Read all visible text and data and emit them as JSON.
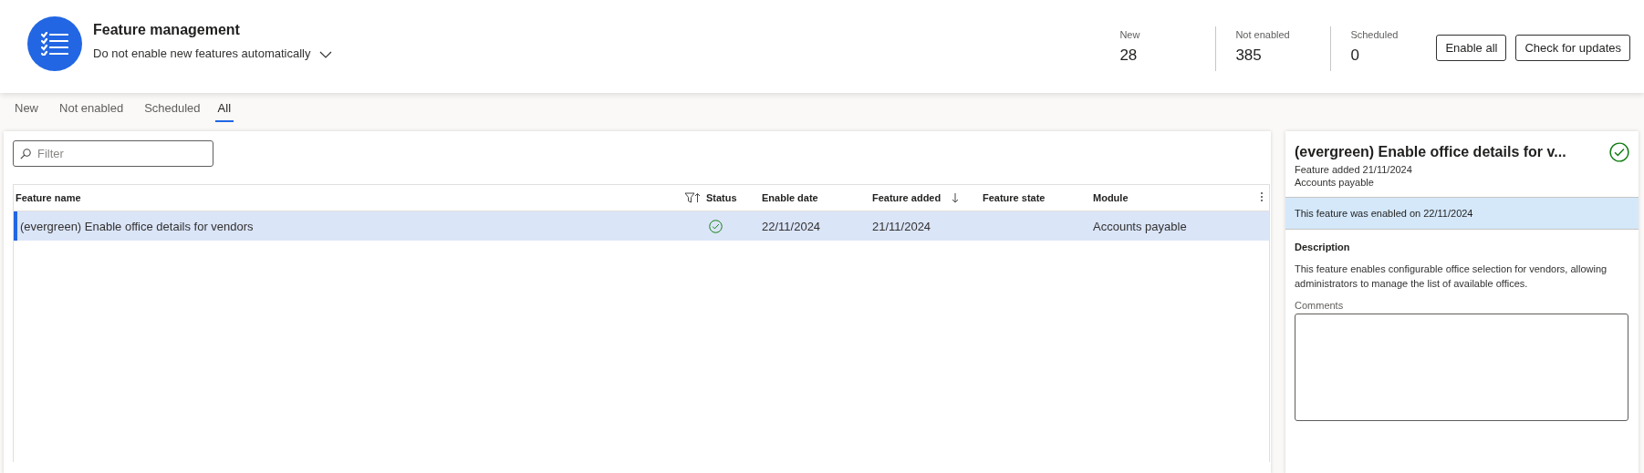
{
  "header": {
    "title": "Feature management",
    "automation_setting": "Do not enable new features automatically"
  },
  "stats": [
    {
      "label": "New",
      "value": "28"
    },
    {
      "label": "Not enabled",
      "value": "385"
    },
    {
      "label": "Scheduled",
      "value": "0"
    }
  ],
  "buttons": [
    "Enable all",
    "Check for updates"
  ],
  "tabs": [
    {
      "label": "New",
      "selected": false
    },
    {
      "label": "Not enabled",
      "selected": false
    },
    {
      "label": "Scheduled",
      "selected": false
    },
    {
      "label": "All",
      "selected": true
    }
  ],
  "filter": {
    "placeholder": "Filter"
  },
  "table": {
    "columns": [
      {
        "label": "Feature name",
        "filtered": true
      },
      {
        "label": "Status",
        "filtered": false
      },
      {
        "label": "Enable date",
        "filtered": false
      },
      {
        "label": "Feature added",
        "filtered": false,
        "sorted_descending": true
      },
      {
        "label": "Feature state",
        "filtered": false
      },
      {
        "label": "Module",
        "filtered": false
      }
    ],
    "rows": [
      {
        "selected": true,
        "name": "(evergreen) Enable office details for vendors",
        "enabled": true,
        "enable_date": "22/11/2024",
        "feature_added": "21/11/2024",
        "module": "Accounts payable"
      }
    ]
  },
  "details": {
    "title": "(evergreen) Enable office details for v...",
    "enabled": true,
    "added": "Feature added 21/11/2024",
    "module": "Accounts payable",
    "banner": "This feature was enabled on 22/11/2024",
    "description_label": "Description",
    "description": "This feature enables configurable office selection for vendors, allowing administrators to manage the list of available offices.",
    "comments_label": "Comments"
  }
}
